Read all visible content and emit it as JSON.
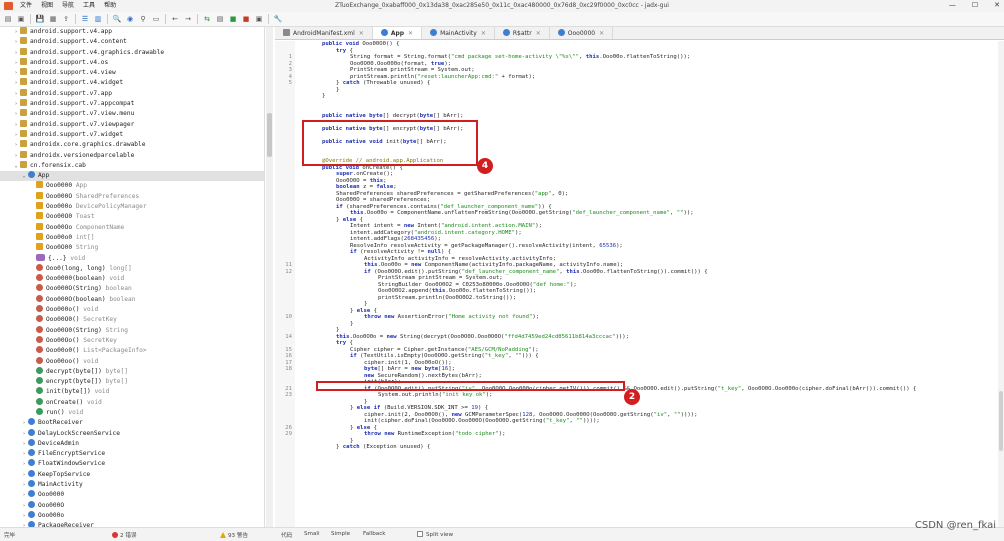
{
  "window": {
    "title": "ZTuoExchange_0xabaff000_0x13da38_0xac285e50_0x11c_0xac480000_0x76d8_0xc29f0000_0xc0cc - jadx-gui",
    "controls": [
      "—",
      "☐",
      "✕"
    ]
  },
  "menu": [
    "文件",
    "视图",
    "导航",
    "工具",
    "帮助"
  ],
  "tree": [
    {
      "label": "android.support.v4.app",
      "icon": "pkg",
      "arrow": "›",
      "indent": 0
    },
    {
      "label": "android.support.v4.content",
      "icon": "pkg",
      "arrow": "›",
      "indent": 0
    },
    {
      "label": "android.support.v4.graphics.drawable",
      "icon": "pkg",
      "arrow": "›",
      "indent": 0
    },
    {
      "label": "android.support.v4.os",
      "icon": "pkg",
      "arrow": "›",
      "indent": 0
    },
    {
      "label": "android.support.v4.view",
      "icon": "pkg",
      "arrow": "›",
      "indent": 0
    },
    {
      "label": "android.support.v4.widget",
      "icon": "pkg",
      "arrow": "›",
      "indent": 0
    },
    {
      "label": "android.support.v7.app",
      "icon": "pkg",
      "arrow": "›",
      "indent": 0
    },
    {
      "label": "android.support.v7.appcompat",
      "icon": "pkg",
      "arrow": "›",
      "indent": 0
    },
    {
      "label": "android.support.v7.view.menu",
      "icon": "pkg",
      "arrow": "›",
      "indent": 0
    },
    {
      "label": "android.support.v7.viewpager",
      "icon": "pkg",
      "arrow": "›",
      "indent": 0
    },
    {
      "label": "android.support.v7.widget",
      "icon": "pkg",
      "arrow": "›",
      "indent": 0
    },
    {
      "label": "androidx.core.graphics.drawable",
      "icon": "pkg",
      "arrow": "›",
      "indent": 0
    },
    {
      "label": "androidx.versionedparcelable",
      "icon": "pkg",
      "arrow": "›",
      "indent": 0
    },
    {
      "label": "cn.forensix.cab",
      "icon": "pkg",
      "arrow": "⌄",
      "indent": 0
    },
    {
      "label": "App",
      "icon": "cls",
      "arrow": "⌄",
      "indent": 1,
      "selected": true
    },
    {
      "label": "Ooo0000",
      "type": "App",
      "icon": "fld",
      "indent": 2
    },
    {
      "label": "Ooo000O",
      "type": "SharedPreferences",
      "icon": "fld",
      "indent": 2
    },
    {
      "label": "Ooo000o",
      "type": "DevicePolicyManager",
      "icon": "fld",
      "indent": 2
    },
    {
      "label": "Ooo00O0",
      "type": "Toast",
      "icon": "fld",
      "indent": 2
    },
    {
      "label": "Ooo00Oo",
      "type": "ComponentName",
      "icon": "fld",
      "indent": 2
    },
    {
      "label": "Ooo00o0",
      "type": "int[]",
      "icon": "fld",
      "indent": 2
    },
    {
      "label": "Ooo0O00",
      "type": "String",
      "icon": "fld",
      "indent": 2
    },
    {
      "label": "{...}",
      "type": "void",
      "icon": "pfx",
      "indent": 2
    },
    {
      "label": "Ooo0(long, long)",
      "type": "long[]",
      "icon": "mth",
      "indent": 2
    },
    {
      "label": "Ooo0000(boolean)",
      "type": "void",
      "icon": "mth",
      "indent": 2
    },
    {
      "label": "Ooo000O(String)",
      "type": "boolean",
      "icon": "mth",
      "indent": 2
    },
    {
      "label": "Ooo000O(boolean)",
      "type": "boolean",
      "icon": "mth",
      "indent": 2
    },
    {
      "label": "Ooo000o()",
      "type": "void",
      "icon": "mth",
      "indent": 2
    },
    {
      "label": "Ooo00O0()",
      "type": "SecretKey",
      "icon": "mth",
      "indent": 2
    },
    {
      "label": "Ooo00O0(String)",
      "type": "String",
      "icon": "mth",
      "indent": 2
    },
    {
      "label": "Ooo00Oo()",
      "type": "SecretKey",
      "icon": "mth",
      "indent": 2
    },
    {
      "label": "Ooo00o0()",
      "type": "List<PackageInfo>",
      "icon": "mth",
      "indent": 2
    },
    {
      "label": "Ooo00oo()",
      "type": "void",
      "icon": "mth",
      "indent": 2
    },
    {
      "label": "decrypt(byte[])",
      "type": "byte[]",
      "icon": "mtg",
      "indent": 2
    },
    {
      "label": "encrypt(byte[])",
      "type": "byte[]",
      "icon": "mtg",
      "indent": 2
    },
    {
      "label": "init(byte[])",
      "type": "void",
      "icon": "mtg",
      "indent": 2
    },
    {
      "label": "onCreate()",
      "type": "void",
      "icon": "mtg",
      "indent": 2
    },
    {
      "label": "run()",
      "type": "void",
      "icon": "mtg",
      "indent": 2
    },
    {
      "label": "BootReceiver",
      "icon": "cls",
      "arrow": "›",
      "indent": 1
    },
    {
      "label": "DelayLockScreenService",
      "icon": "cls",
      "arrow": "›",
      "indent": 1
    },
    {
      "label": "DeviceAdmin",
      "icon": "cls",
      "arrow": "›",
      "indent": 1
    },
    {
      "label": "FileEncryptService",
      "icon": "cls",
      "arrow": "›",
      "indent": 1
    },
    {
      "label": "FloatWindowService",
      "icon": "cls",
      "arrow": "›",
      "indent": 1
    },
    {
      "label": "KeepTopService",
      "icon": "cls",
      "arrow": "›",
      "indent": 1
    },
    {
      "label": "MainActivity",
      "icon": "cls",
      "arrow": "›",
      "indent": 1
    },
    {
      "label": "Ooo0000",
      "icon": "cls",
      "arrow": "›",
      "indent": 1
    },
    {
      "label": "Ooo000O",
      "icon": "cls",
      "arrow": "›",
      "indent": 1
    },
    {
      "label": "Ooo000o",
      "icon": "cls",
      "arrow": "›",
      "indent": 1
    },
    {
      "label": "PackageReceiver",
      "icon": "cls",
      "arrow": "›",
      "indent": 1
    }
  ],
  "tabs": [
    {
      "label": "AndroidManifest.xml",
      "icon": "xml"
    },
    {
      "label": "App",
      "icon": "cls",
      "active": true
    },
    {
      "label": "MainActivity",
      "icon": "cls"
    },
    {
      "label": "R$attr",
      "icon": "cls"
    },
    {
      "label": "Ooo0000",
      "icon": "cls"
    }
  ],
  "code": [
    {
      "g": "",
      "i": 1,
      "t": "<span class='kw'>public void</span> Ooo00O0() {"
    },
    {
      "g": "",
      "i": 2,
      "t": "<span class='kw'>try</span> {"
    },
    {
      "g": "1",
      "i": 3,
      "t": "String format = String.format(<span class='st'>\"cmd package set-home-activity \\\"%s\\\"\"</span>, <span class='kw'>this</span>.Ooo00o.flattenToString());"
    },
    {
      "g": "2",
      "i": 3,
      "t": "Ooo0O00.Ooo000o(format, <span class='kw'>true</span>);"
    },
    {
      "g": "3",
      "i": 3,
      "t": "PrintStream printStream = System.out;"
    },
    {
      "g": "4",
      "i": 3,
      "t": "printStream.println(<span class='st'>\"reset:launcherApp:cmd:\"</span> + format);"
    },
    {
      "g": "5",
      "i": 2,
      "t": "} <span class='kw'>catch</span> (Throwable unused) {"
    },
    {
      "g": "",
      "i": 2,
      "t": "}"
    },
    {
      "g": "",
      "i": 1,
      "t": "}"
    },
    {
      "g": "",
      "i": 0,
      "t": ""
    },
    {
      "g": "",
      "i": 0,
      "t": ""
    },
    {
      "g": "",
      "i": 1,
      "t": "<span class='kw'>public native</span> <span class='kw'>byte</span>[] decrypt(<span class='kw'>byte</span>[] bArr);"
    },
    {
      "g": "",
      "i": 0,
      "t": ""
    },
    {
      "g": "",
      "i": 1,
      "t": "<span class='kw'>public native</span> <span class='kw'>byte</span>[] encrypt(<span class='kw'>byte</span>[] bArr);"
    },
    {
      "g": "",
      "i": 0,
      "t": ""
    },
    {
      "g": "",
      "i": 1,
      "t": "<span class='kw'>public native void</span> init(<span class='kw'>byte</span>[] bArr);"
    },
    {
      "g": "",
      "i": 0,
      "t": ""
    },
    {
      "g": "",
      "i": 0,
      "t": ""
    },
    {
      "g": "",
      "i": 1,
      "t": "<span class='an'>@Override // android.app.Application</span>"
    },
    {
      "g": "",
      "i": 1,
      "t": "<span class='kw'>public void</span> onCreate() {"
    },
    {
      "g": "",
      "i": 2,
      "t": "<span class='kw'>super</span>.onCreate();"
    },
    {
      "g": "",
      "i": 2,
      "t": "Ooo0O0O = <span class='kw'>this</span>;"
    },
    {
      "g": "",
      "i": 2,
      "t": "<span class='kw'>boolean</span> z = <span class='kw'>false</span>;"
    },
    {
      "g": "",
      "i": 2,
      "t": "SharedPreferences sharedPreferences = getSharedPreferences(<span class='st'>\"app\"</span>, 0);"
    },
    {
      "g": "",
      "i": 2,
      "t": "Ooo000O = sharedPreferences;"
    },
    {
      "g": "",
      "i": 2,
      "t": "<span class='kw'>if</span> (sharedPreferences.contains(<span class='st'>\"def_launcher_component_name\"</span>)) {"
    },
    {
      "g": "",
      "i": 3,
      "t": "<span class='kw'>this</span>.Ooo00o = ComponentName.unflattenFromString(Ooo0O0O.getString(<span class='st'>\"def_launcher_component_name\"</span>, <span class='st'>\"\"</span>));"
    },
    {
      "g": "",
      "i": 2,
      "t": "} <span class='kw'>else</span> {"
    },
    {
      "g": "",
      "i": 3,
      "t": "Intent intent = <span class='kw'>new</span> Intent(<span class='st'>\"android.intent.action.MAIN\"</span>);"
    },
    {
      "g": "",
      "i": 3,
      "t": "intent.addCategory(<span class='st'>\"android.intent.category.HOME\"</span>);"
    },
    {
      "g": "",
      "i": 3,
      "t": "intent.addFlags(<span class='nm'>268435456</span>);"
    },
    {
      "g": "",
      "i": 3,
      "t": "ResolveInfo resolveActivity = getPackageManager().resolveActivity(intent, <span class='nm'>65536</span>);"
    },
    {
      "g": "",
      "i": 3,
      "t": "<span class='kw'>if</span> (resolveActivity != <span class='kw'>null</span>) {"
    },
    {
      "g": "",
      "i": 4,
      "t": "ActivityInfo activityInfo = resolveActivity.activityInfo;"
    },
    {
      "g": "11",
      "i": 4,
      "t": "<span class='kw'>this</span>.Ooo00o = <span class='kw'>new</span> ComponentName(activityInfo.packageName, activityInfo.name);"
    },
    {
      "g": "12",
      "i": 4,
      "t": "<span class='kw'>if</span> (Ooo0O0O.edit().putString(<span class='st'>\"def_launcher_component_name\"</span>, <span class='kw'>this</span>.Ooo00o.flattenToString()).commit()) {"
    },
    {
      "g": "",
      "i": 5,
      "t": "PrintStream printStream = System.out;"
    },
    {
      "g": "",
      "i": 5,
      "t": "StringBuilder Ooo0O0O2 = C0253o80000o.Ooo0O0O(<span class='st'>\"def home:\"</span>);"
    },
    {
      "g": "",
      "i": 5,
      "t": "Ooo0O0O2.append(<span class='kw'>this</span>.Ooo00o.flattenToString());"
    },
    {
      "g": "",
      "i": 5,
      "t": "printStream.println(Ooo0O0O2.toString());"
    },
    {
      "g": "",
      "i": 4,
      "t": "}"
    },
    {
      "g": "",
      "i": 3,
      "t": "} <span class='kw'>else</span> {"
    },
    {
      "g": "10",
      "i": 4,
      "t": "<span class='kw'>throw new</span> AssertionError(<span class='st'>\"Home activity not found\"</span>);"
    },
    {
      "g": "",
      "i": 3,
      "t": "}"
    },
    {
      "g": "",
      "i": 2,
      "t": "}"
    },
    {
      "g": "14",
      "i": 2,
      "t": "<span class='kw'>this</span>.Ooo0O0o = <span class='kw'>new</span> String(decrypt(Ooo0O0O.Ooo0O0O(<span class='st'>\"ffd4d7459ed24cd85611b814a3cccac\"</span>)));"
    },
    {
      "g": "",
      "i": 2,
      "t": "<span class='kw'>try</span> {"
    },
    {
      "g": "15",
      "i": 3,
      "t": "Cipher cipher = Cipher.getInstance(<span class='st'>\"AES/GCM/NoPadding\"</span>);"
    },
    {
      "g": "16",
      "i": 3,
      "t": "<span class='kw'>if</span> (TextUtils.isEmpty(Ooo0O0O.getString(<span class='st'>\"t_key\"</span>, <span class='st'>\"\"</span>))) {"
    },
    {
      "g": "17",
      "i": 4,
      "t": "cipher.init(1, Ooo00oO());"
    },
    {
      "g": "18",
      "i": 4,
      "t": "<span class='kw'>byte</span>[] bArr = <span class='kw'>new byte</span>[<span class='nm'>16</span>];"
    },
    {
      "g": "",
      "i": 4,
      "t": "<span class='kw'>new</span> SecureRandom().nextBytes(bArr);"
    },
    {
      "g": "",
      "i": 4,
      "t": "init(bArr);"
    },
    {
      "g": "21",
      "i": 4,
      "t": "<span class='kw'>if</span> (Ooo0O0O.edit().putString(<span class='st'>\"iv\"</span>, Ooo0O0O.Ooo000o(cipher.getIV())).commit() &amp;&amp; Ooo0O0O.edit().putString(<span class='st'>\"t_key\"</span>, Ooo0O0O.Ooo000o(cipher.doFinal(bArr))).commit()) {"
    },
    {
      "g": "23",
      "i": 5,
      "t": "System.out.println(<span class='st'>\"init key ok\"</span>);"
    },
    {
      "g": "",
      "i": 4,
      "t": "}"
    },
    {
      "g": "",
      "i": 3,
      "t": "} <span class='kw'>else if</span> (Build.VERSION.SDK_INT &gt;= <span class='nm'>19</span>) {"
    },
    {
      "g": "",
      "i": 4,
      "t": "cipher.init(2, Ooo00O0(), <span class='kw'>new</span> GCMParameterSpec(<span class='nm'>128</span>, Ooo0O0O.Ooo000O(Ooo0O0O.getString(<span class='st'>\"iv\"</span>, <span class='st'>\"\"</span>))));"
    },
    {
      "g": "",
      "i": 4,
      "t": "init(cipher.doFinal(Ooo0O0O.Ooo000O(Ooo0O0O.getString(<span class='st'>\"t_key\"</span>, <span class='st'>\"\"</span>))));"
    },
    {
      "g": "26",
      "i": 3,
      "t": "} <span class='kw'>else</span> {"
    },
    {
      "g": "29",
      "i": 4,
      "t": "<span class='kw'>throw new</span> RuntimeException(<span class='st'>\"todo cipher\"</span>);"
    },
    {
      "g": "",
      "i": 3,
      "t": "}"
    },
    {
      "g": "",
      "i": 2,
      "t": "} <span class='kw'>catch</span> (Exception unused) {"
    }
  ],
  "annotations": {
    "badge4": "4",
    "badge2": "2"
  },
  "status": {
    "left": "完毕",
    "errors": "2 错误",
    "warnings": "93 警告",
    "modes": [
      "代码",
      "Smali",
      "Simple",
      "Fallback"
    ],
    "split": "Split view"
  },
  "watermark": "CSDN @ren_fkai"
}
